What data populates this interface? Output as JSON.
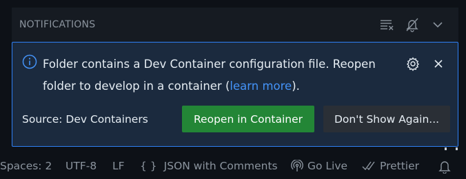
{
  "header": {
    "title": "NOTIFICATIONS",
    "icons": [
      "clear-all-icon",
      "do-not-disturb-bell-icon",
      "chevron-down-icon"
    ]
  },
  "notification": {
    "message_before": "Folder contains a Dev Container configuration file. Reopen folder to develop in a container (",
    "link_text": "learn more",
    "message_after": ").",
    "source": "Source: Dev Containers",
    "primary_button": "Reopen in Container",
    "secondary_button": "Don't Show Again...",
    "icons": [
      "info-icon",
      "gear-icon",
      "close-icon"
    ]
  },
  "statusbar": {
    "spaces": "Spaces: 2",
    "encoding": "UTF-8",
    "eol": "LF",
    "language_icon": "{ }",
    "language": "JSON with Comments",
    "go_live": "Go Live",
    "prettier": "Prettier",
    "icons": [
      "broadcast-icon",
      "double-check-icon",
      "bell-icon"
    ]
  },
  "colors": {
    "accent": "#2f81f7",
    "link": "#4493f8",
    "primary_button": "#238636",
    "card_background": "#1b2a3e"
  }
}
